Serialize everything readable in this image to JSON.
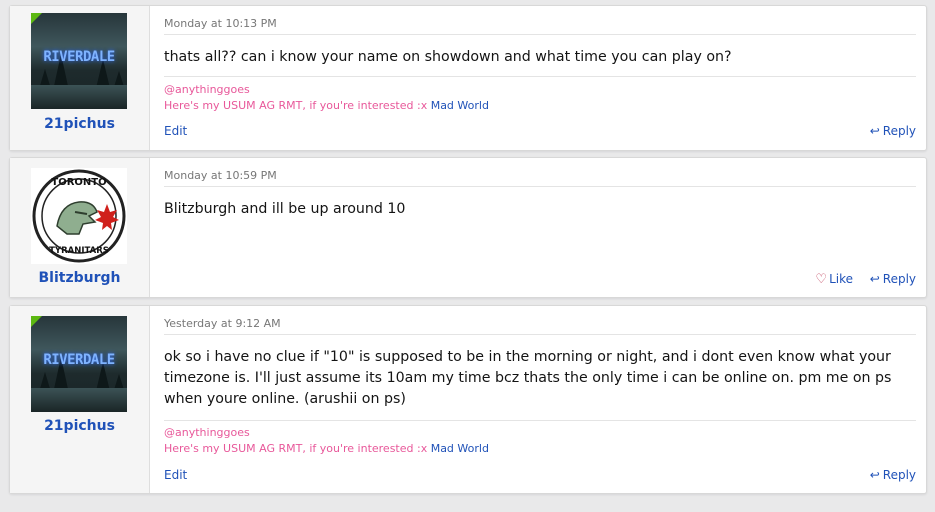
{
  "posts": [
    {
      "username": "21pichus",
      "avatar_text": "RIVERDALE",
      "date": "Monday at 10:13 PM",
      "message": "thats all?? can i know your name on showdown and what time you can play on?",
      "signature": {
        "mention": "@anythinggoes",
        "text": "Here's my USUM AG RMT, if you're interested :x",
        "link": "Mad World"
      },
      "edit_label": "Edit",
      "reply_label": "Reply"
    },
    {
      "username": "Blitzburgh",
      "avatar_text_top": "TORONTO",
      "avatar_text_bottom": "TYRANITARS",
      "date": "Monday at 10:59 PM",
      "message": "Blitzburgh and ill be up around 10",
      "like_label": "Like",
      "reply_label": "Reply"
    },
    {
      "username": "21pichus",
      "avatar_text": "RIVERDALE",
      "date": "Yesterday at 9:12 AM",
      "message": "ok so i have no clue if \"10\" is supposed to be in the morning or night, and i dont even know what your timezone is. I'll just assume its 10am my time bcz thats the only time i can be online on. pm me on ps when youre online. (arushii on ps)",
      "signature": {
        "mention": "@anythinggoes",
        "text": "Here's my USUM AG RMT, if you're interested :x",
        "link": "Mad World"
      },
      "edit_label": "Edit",
      "reply_label": "Reply"
    }
  ],
  "colors": {
    "link": "#2052b8",
    "signature_pink": "#e8589a",
    "online": "#5cb811"
  }
}
